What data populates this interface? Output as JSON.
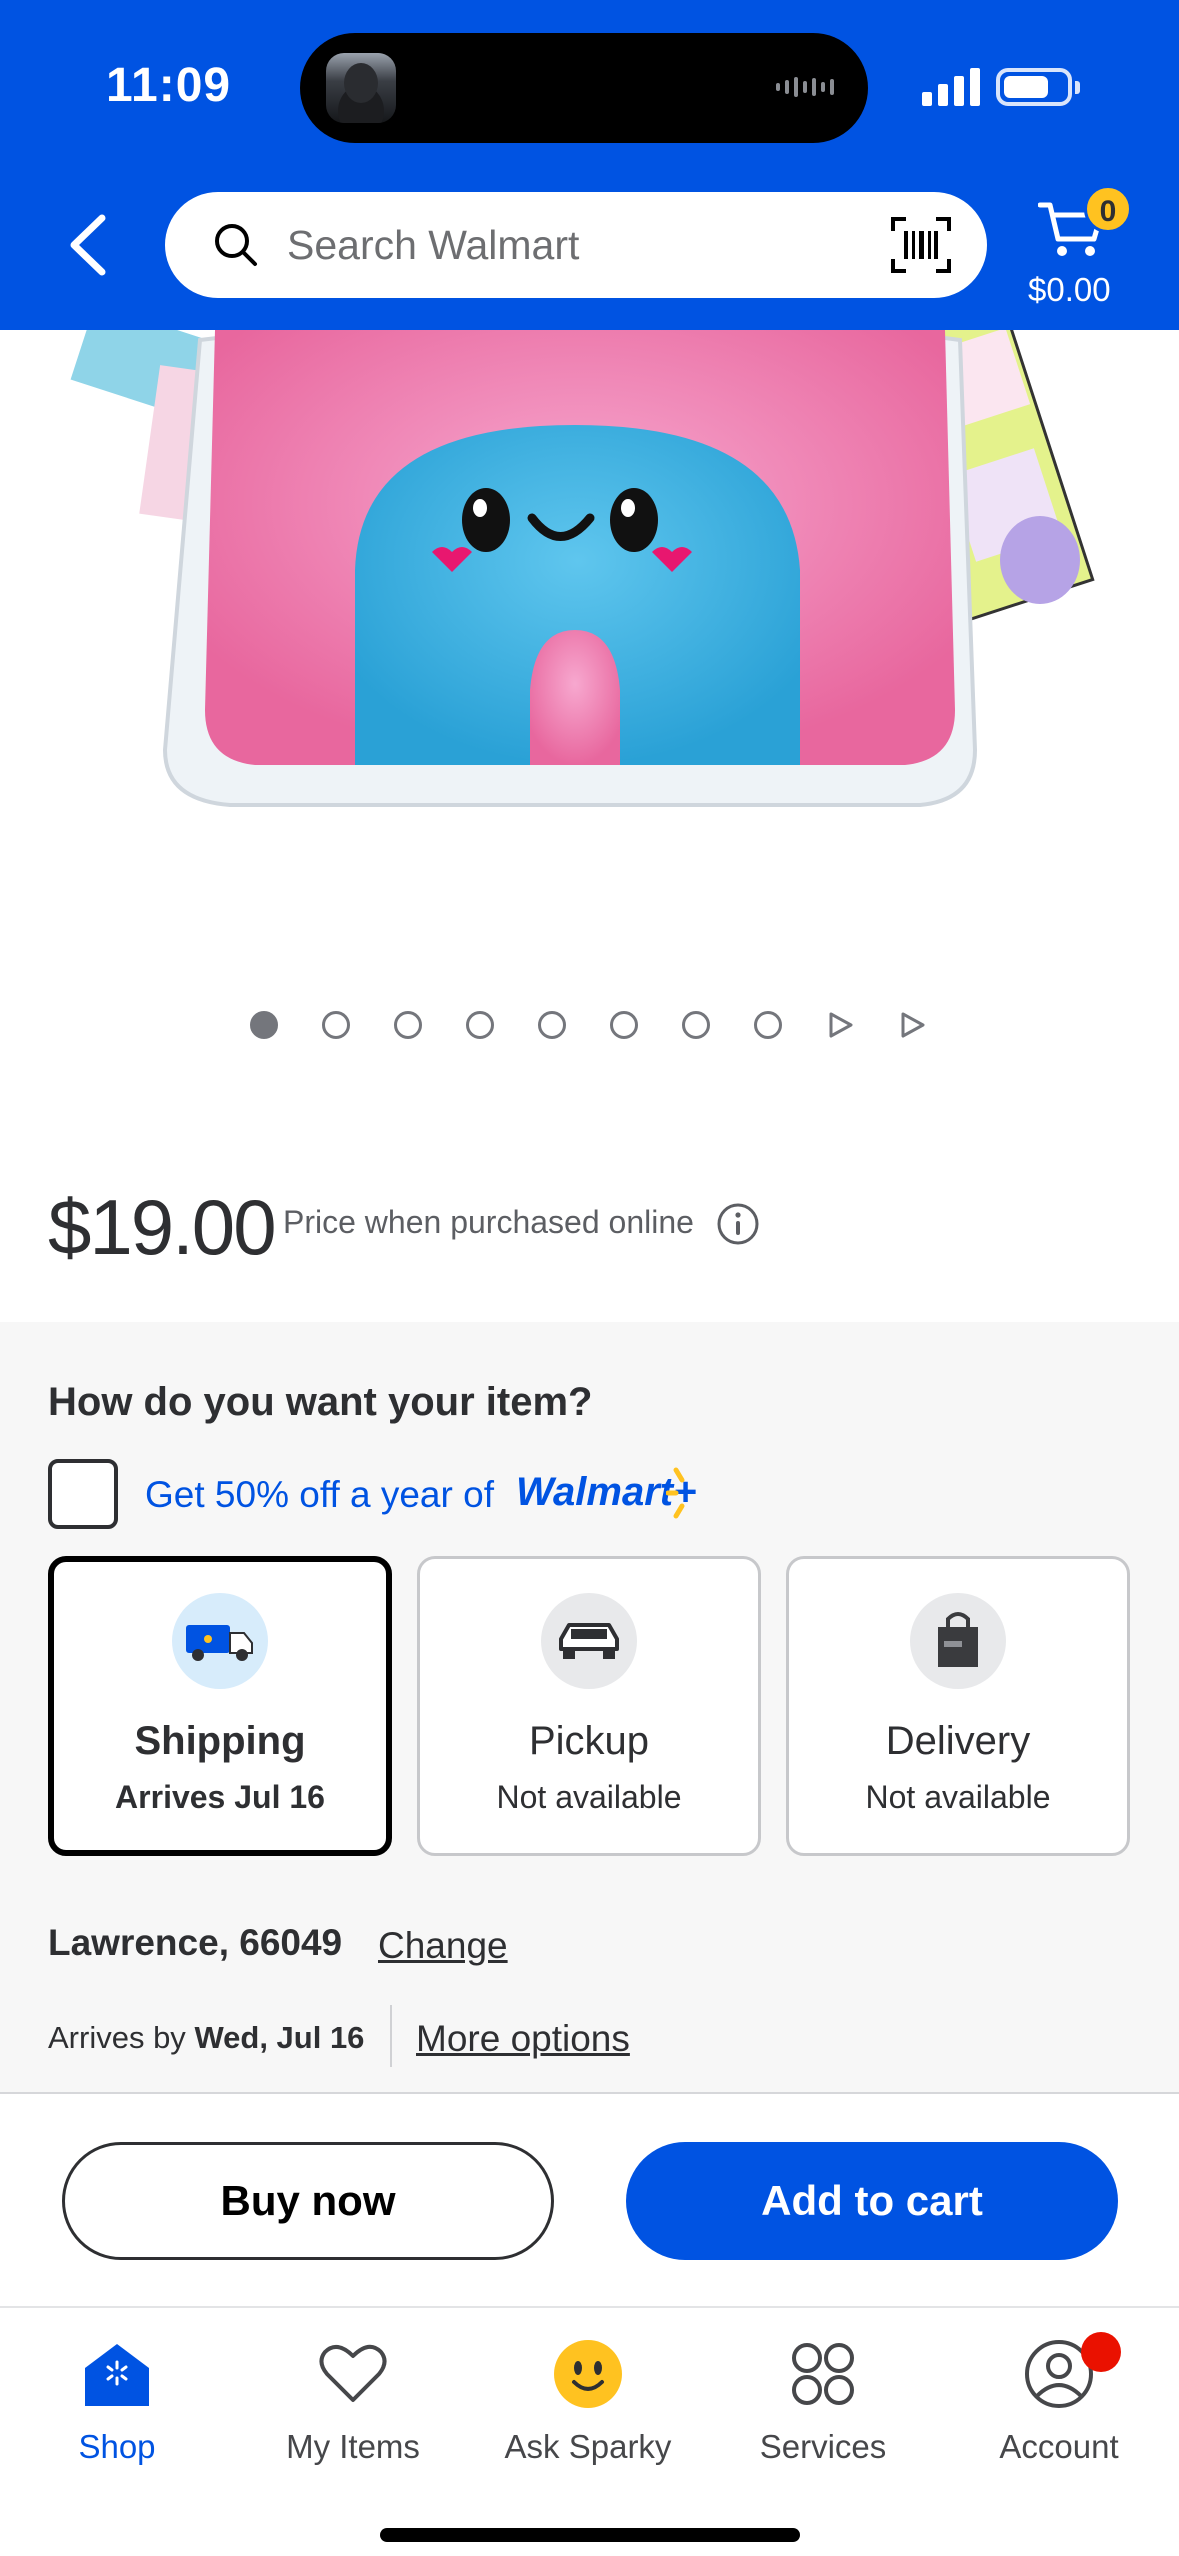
{
  "status_bar": {
    "time": "11:09"
  },
  "header": {
    "search_placeholder": "Search Walmart",
    "cart_count": "0",
    "cart_total": "$0.00",
    "brand_color": "#0053e2",
    "accent_color": "#ffc220"
  },
  "gallery": {
    "dots_total": 8,
    "active_index": 0,
    "video_items": 2
  },
  "price": {
    "amount": "$19.00",
    "note": "Price when purchased online"
  },
  "fulfillment": {
    "title": "How do you want your item?",
    "walmart_plus_offer": "Get 50% off a year of",
    "walmart_plus_logo": "Walmart+",
    "options": [
      {
        "label": "Shipping",
        "sub": "Arrives Jul 16",
        "selected": true
      },
      {
        "label": "Pickup",
        "sub": "Not available",
        "selected": false
      },
      {
        "label": "Delivery",
        "sub": "Not available",
        "selected": false
      }
    ],
    "location": "Lawrence, 66049",
    "change_label": "Change",
    "arrives_prefix": "Arrives by",
    "arrives_date": "Wed, Jul 16",
    "more_options_label": "More options"
  },
  "actions": {
    "buy_now": "Buy now",
    "add_to_cart": "Add to cart"
  },
  "tabbar": {
    "items": [
      {
        "label": "Shop",
        "icon": "shop-icon",
        "active": true
      },
      {
        "label": "My Items",
        "icon": "heart-icon",
        "active": false
      },
      {
        "label": "Ask Sparky",
        "icon": "sparky-icon",
        "active": false
      },
      {
        "label": "Services",
        "icon": "services-icon",
        "active": false
      },
      {
        "label": "Account",
        "icon": "account-icon",
        "active": false
      }
    ]
  }
}
